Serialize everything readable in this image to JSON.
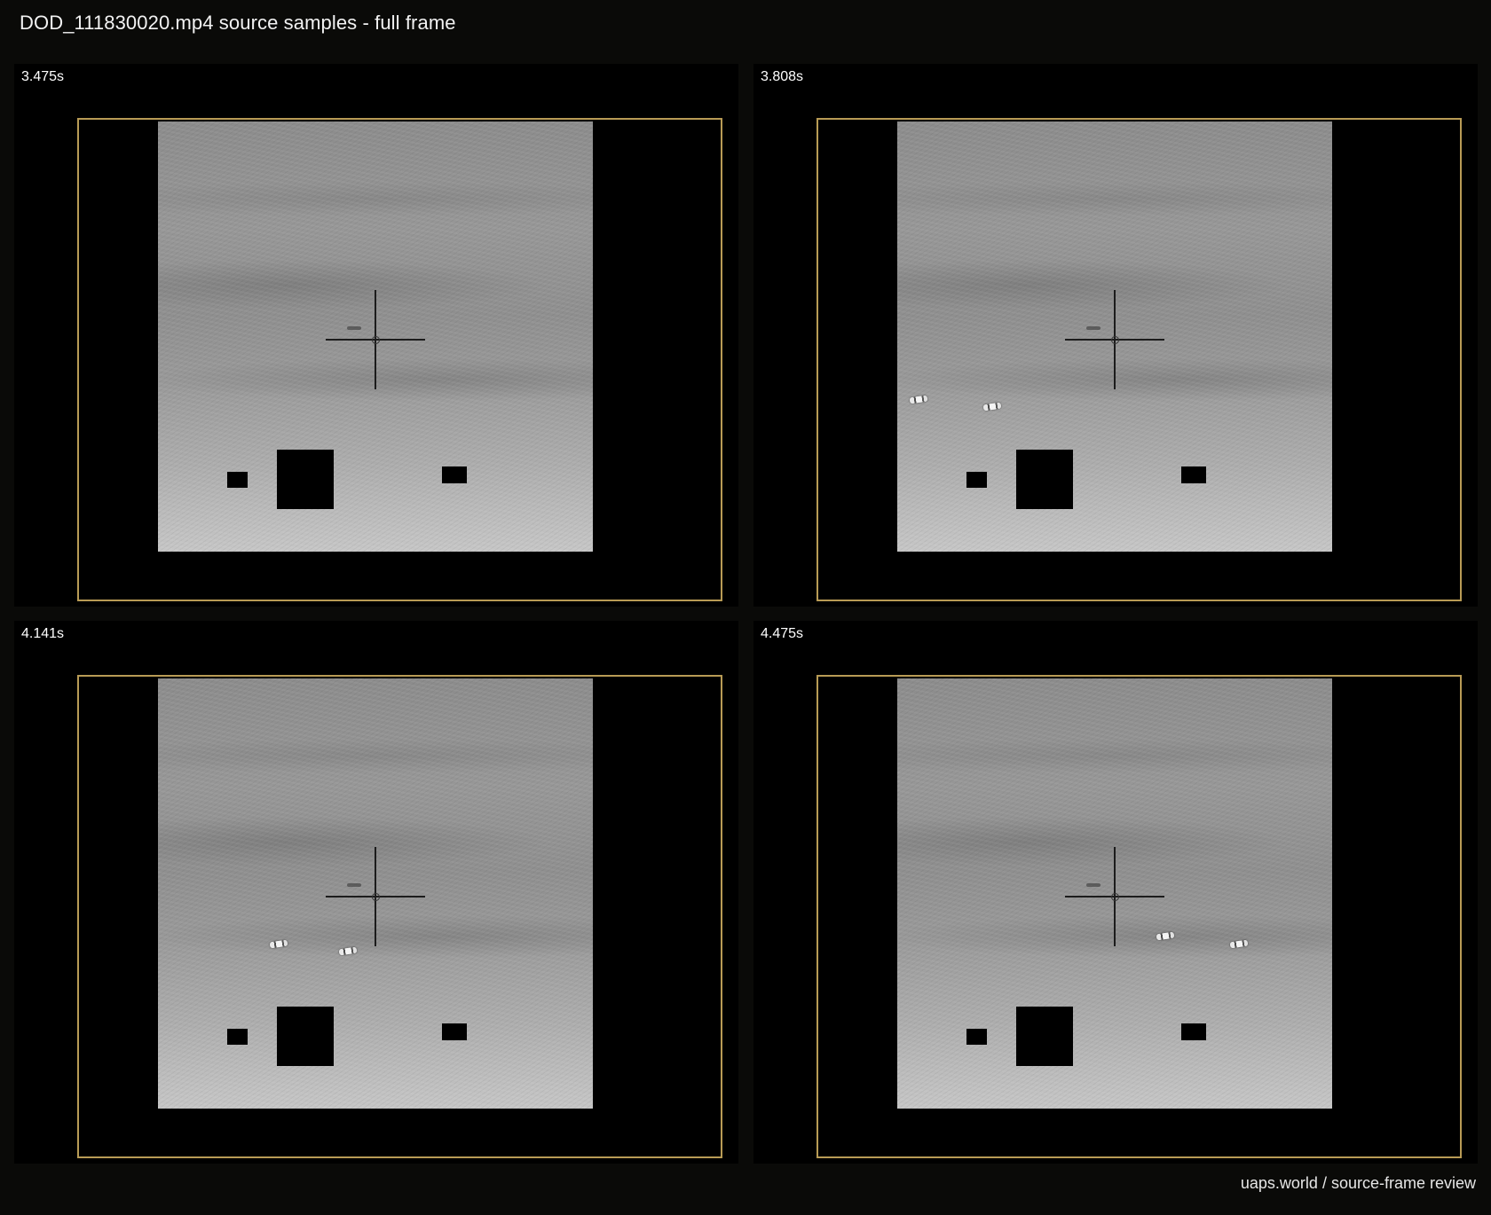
{
  "page": {
    "title": "DOD_111830020.mp4 source samples - full frame",
    "footer": "uaps.world / source-frame review"
  },
  "panels": [
    {
      "time": "3.475s"
    },
    {
      "time": "3.808s"
    },
    {
      "time": "4.141s"
    },
    {
      "time": "4.475s"
    }
  ],
  "colors": {
    "background": "#0a0a08",
    "panel": "#000000",
    "frame_outline": "#b89b55",
    "text": "#f2f2f2"
  }
}
